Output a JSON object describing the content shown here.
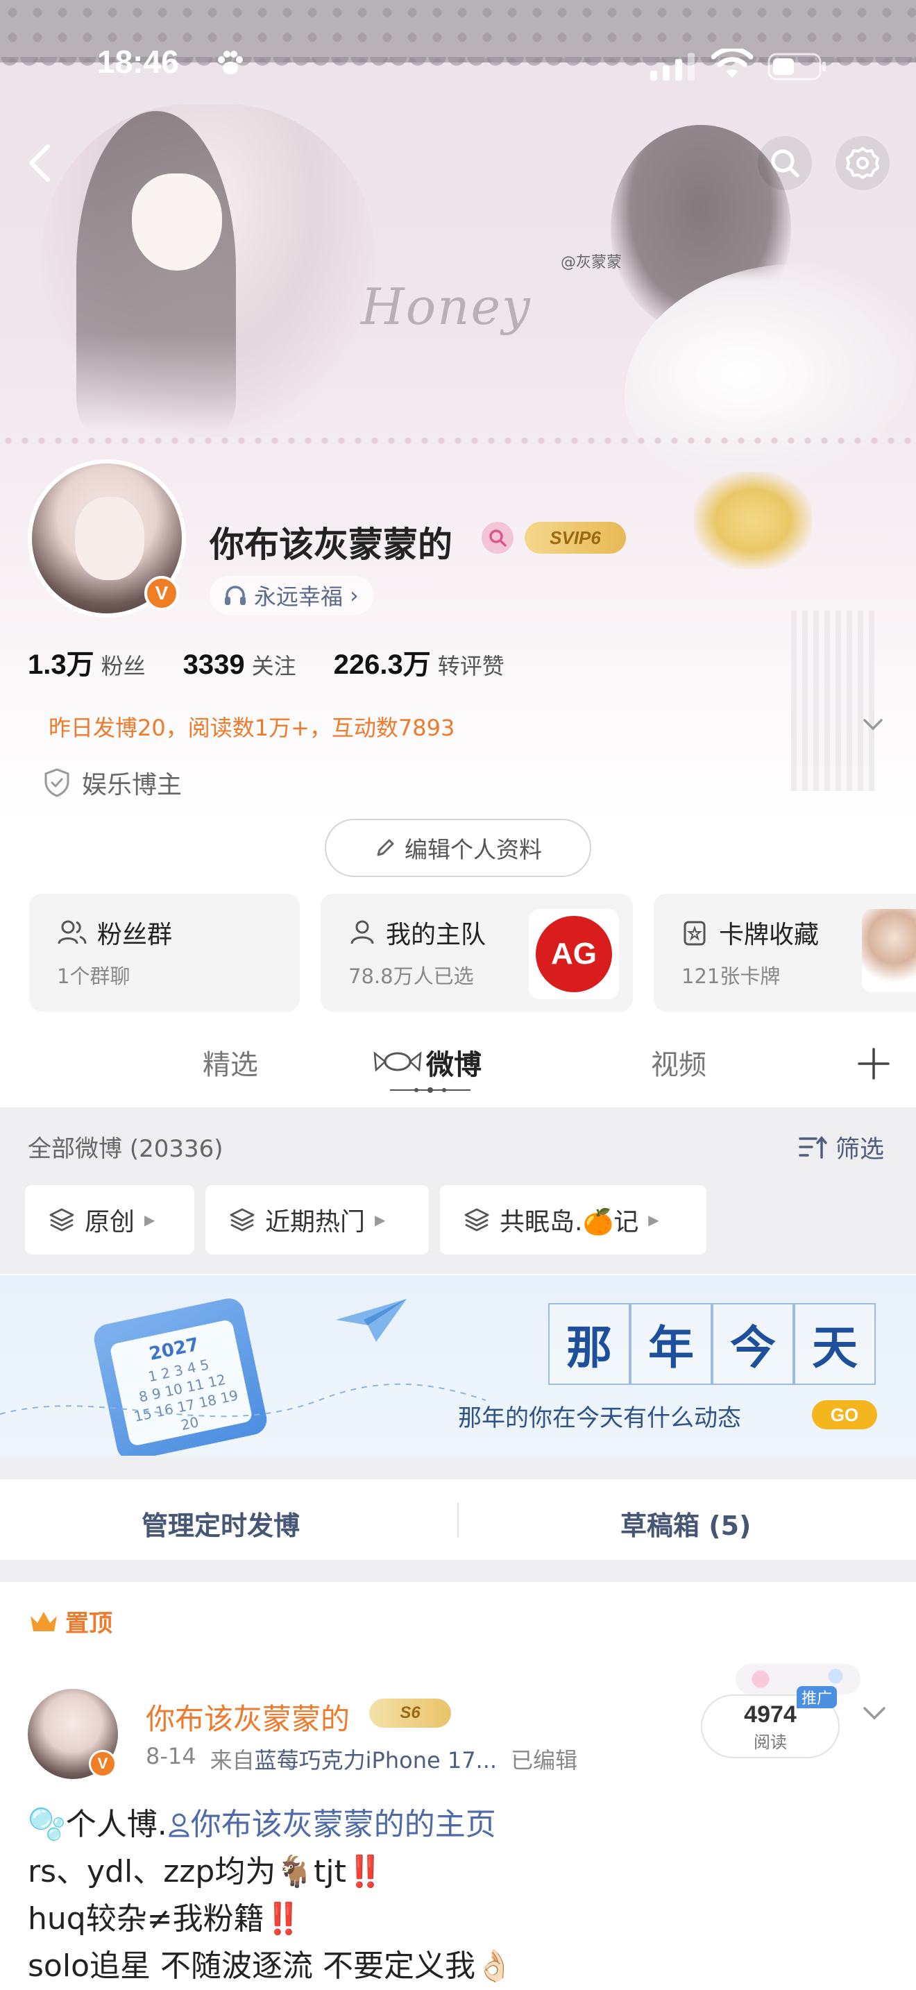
{
  "status_bar": {
    "time": "18:46"
  },
  "banner": {
    "handle_watermark": "@灰蒙蒙",
    "art_text": "Honey"
  },
  "profile": {
    "nickname": "你布该灰蒙蒙的",
    "vip_badge": "SVIP6",
    "verified_mark": "V",
    "music_tag": "永远幸福",
    "stats": [
      {
        "value": "1.3万",
        "label": "粉丝"
      },
      {
        "value": "3339",
        "label": "关注"
      },
      {
        "value": "226.3万",
        "label": "转评赞"
      }
    ],
    "activity": "昨日发博20，阅读数1万+，互动数7893",
    "role": "娱乐博主",
    "edit_button": "编辑个人资料"
  },
  "cards": [
    {
      "title": "粉丝群",
      "sub": "1个群聊"
    },
    {
      "title": "我的主队",
      "sub": "78.8万人已选",
      "logo_text": "AG"
    },
    {
      "title": "卡牌收藏",
      "sub": "121张卡牌"
    }
  ],
  "tabs": [
    "精选",
    "微博",
    "视频"
  ],
  "feed": {
    "count_label": "全部微博 (20336)",
    "filter_label": "筛选",
    "chips": [
      "原创",
      "近期热门",
      "共眠岛.🍊记"
    ]
  },
  "memory": {
    "title_chars": [
      "那",
      "年",
      "今",
      "天"
    ],
    "subtitle": "那年的你在今天有什么动态",
    "go_label": "GO",
    "calendar_year": "2027",
    "calendar_digits": "1 2 3 4 5\n8 9 10 11 12\n15 16 17 18 19 20"
  },
  "actions": {
    "scheduled": "管理定时发博",
    "drafts": "草稿箱 (5)"
  },
  "post": {
    "pinned_label": "置顶",
    "author": "你布该灰蒙蒙的",
    "author_badge": "S6",
    "date": "8-14",
    "source_prefix": "来自",
    "source": "蓝莓巧克力iPhone 17...",
    "edited": "已编辑",
    "reads": "4974",
    "reads_label": "阅读",
    "promo_label": "推广",
    "lines": {
      "l1_emoji": "🫧",
      "l1_text": "个人博.",
      "l1_link": "你布该灰蒙蒙的的主页",
      "l2_text": "rs、ydl、zzp均为",
      "l2_emoji": "🐐",
      "l2_tail": "tjt",
      "l2_mark": "‼️",
      "l3_text": "huq较杂≠我粉籍",
      "l3_mark": "‼️",
      "l4_text": "solo追星 不随波逐流 不要定义我",
      "l4_emoji": "👌🏻"
    }
  },
  "colors": {
    "accent_orange": "#ef7a2c",
    "link_blue": "#4e5d80",
    "ag_red": "#d91d1d",
    "go_yellow": "#f5b51f"
  }
}
